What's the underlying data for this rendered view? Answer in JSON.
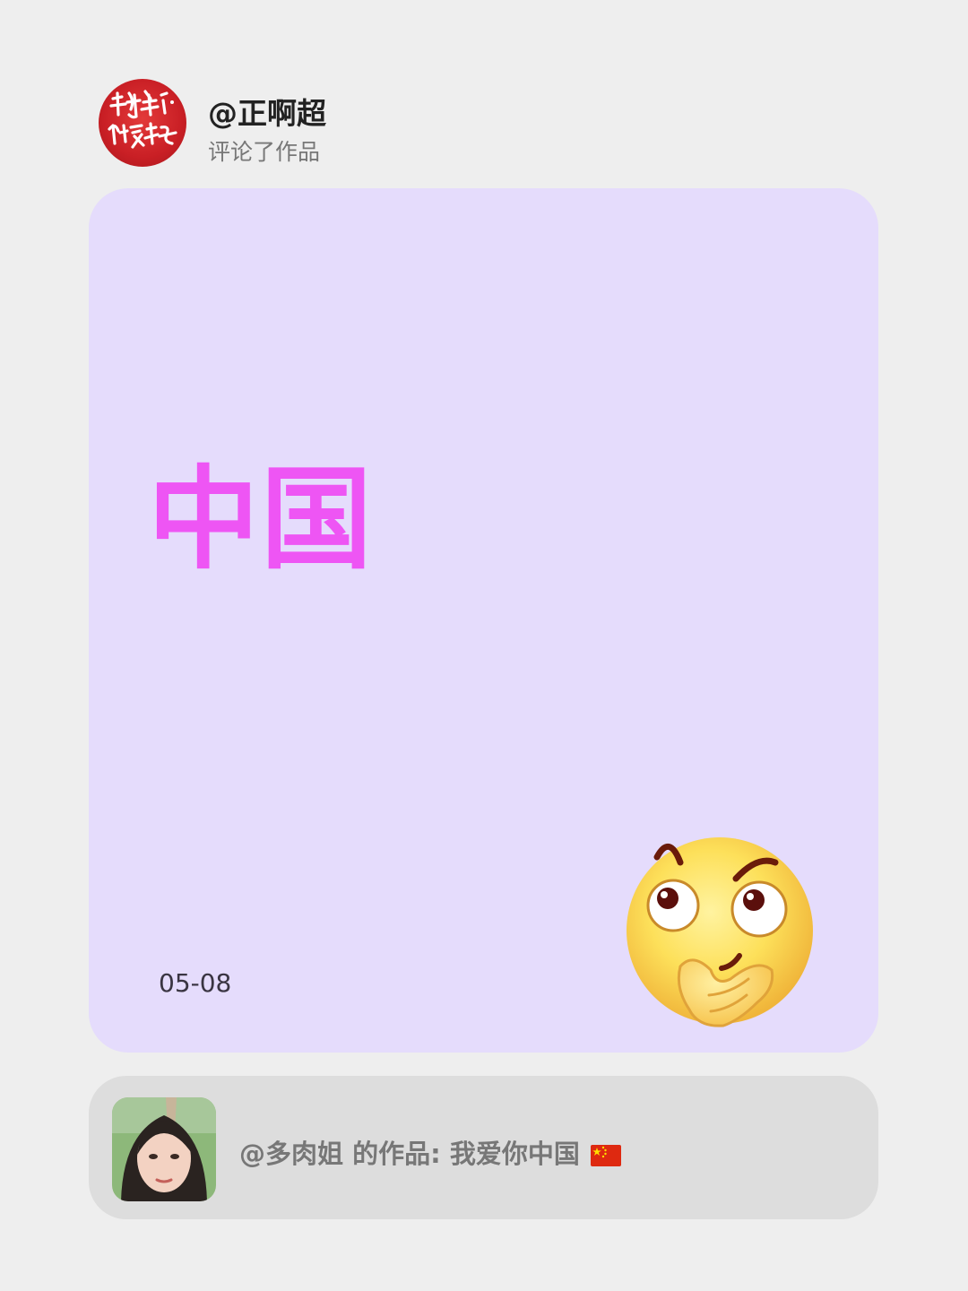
{
  "notification": {
    "username": "@正啊超",
    "action": "评论了作品",
    "avatar_text": "坚持做最好的自己",
    "avatar_icon": "calligraphy-avatar-icon"
  },
  "comment": {
    "text": "中国",
    "text_color": "#ee55f4",
    "card_color": "#e5dcfc",
    "date": "05-08",
    "emoji_icon": "thinking-face-icon"
  },
  "referenced_work": {
    "author": "@多肉姐",
    "text": "的作品: 我爱你中国",
    "flag_icon": "china-flag-icon",
    "thumbnail_icon": "author-photo-icon"
  }
}
